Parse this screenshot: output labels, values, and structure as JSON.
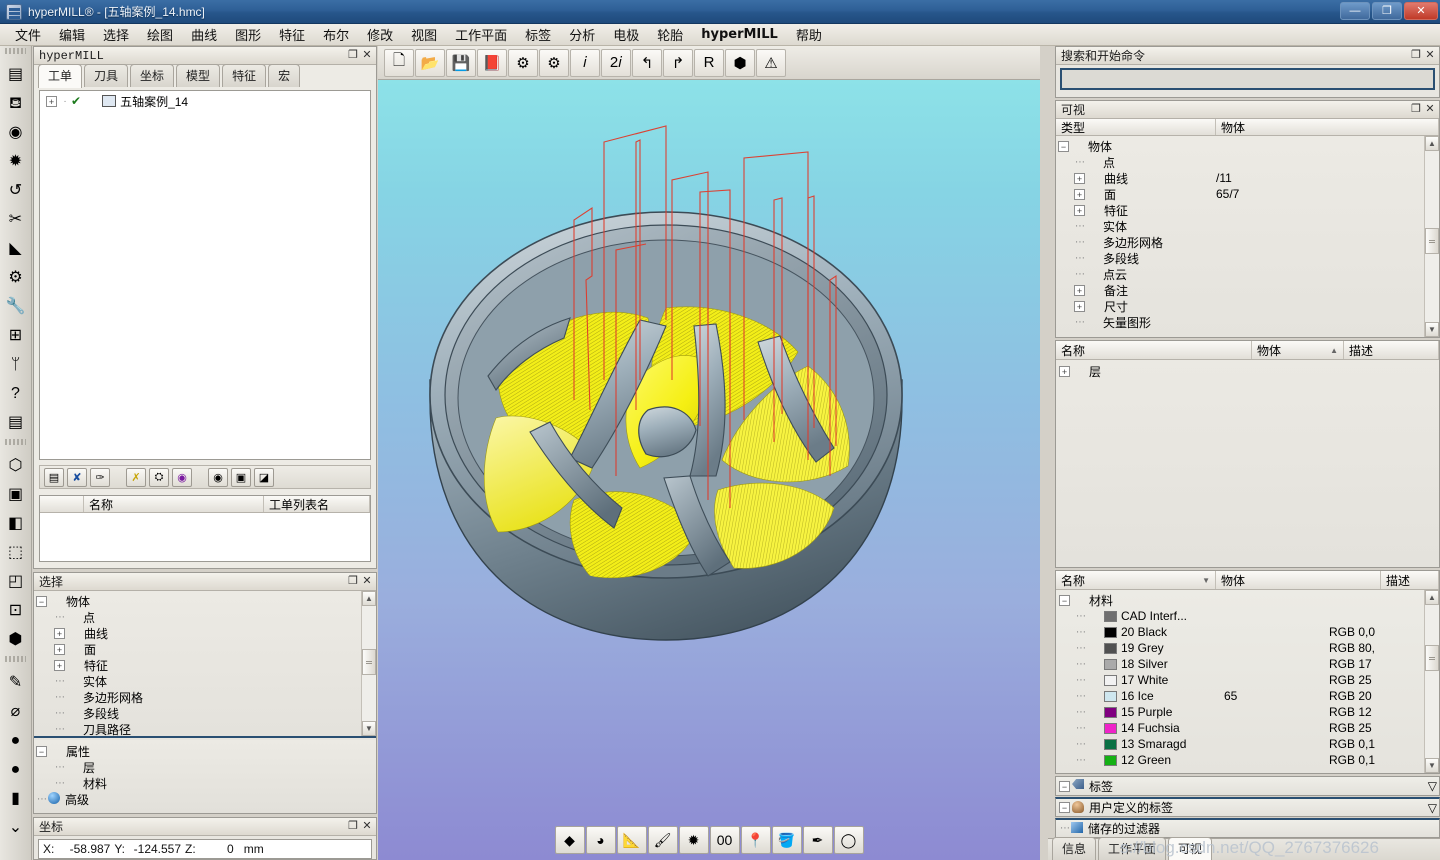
{
  "window": {
    "title": "hyperMILL® - [五轴案例_14.hmc]",
    "minimize_label": "—",
    "maximize_label": "❐",
    "close_label": "✕"
  },
  "menu": {
    "items": [
      {
        "label": "文件"
      },
      {
        "label": "编辑"
      },
      {
        "label": "选择"
      },
      {
        "label": "绘图"
      },
      {
        "label": "曲线"
      },
      {
        "label": "图形"
      },
      {
        "label": "特征"
      },
      {
        "label": "布尔"
      },
      {
        "label": "修改"
      },
      {
        "label": "视图"
      },
      {
        "label": "工作平面"
      },
      {
        "label": "标签"
      },
      {
        "label": "分析"
      },
      {
        "label": "电极"
      },
      {
        "label": "轮胎"
      },
      {
        "label": "hyperMILL"
      },
      {
        "label": "帮助"
      }
    ]
  },
  "left_toolbar": {
    "group1": [
      {
        "icon": "layers-icon",
        "glyph": "▤"
      },
      {
        "icon": "pour-icon",
        "glyph": "⛾"
      },
      {
        "icon": "target-disc-icon",
        "glyph": "◉"
      },
      {
        "icon": "star-layers-icon",
        "glyph": "✹"
      },
      {
        "icon": "undo-arrow-icon",
        "glyph": "↺"
      },
      {
        "icon": "scissors-icon",
        "glyph": "✂"
      },
      {
        "icon": "ribbon-icon",
        "glyph": "◣"
      },
      {
        "icon": "machine-icon",
        "glyph": "⚙"
      },
      {
        "icon": "wrench-icon",
        "glyph": "🔧"
      },
      {
        "icon": "grid-four-icon",
        "glyph": "⊞"
      },
      {
        "icon": "figure-icon",
        "glyph": "ᛘ"
      },
      {
        "icon": "help-question-icon",
        "glyph": "?"
      },
      {
        "icon": "document-list-icon",
        "glyph": "▤"
      }
    ],
    "group2": [
      {
        "icon": "cube-iso-icon",
        "glyph": "⬡"
      },
      {
        "icon": "cube-solid-icon",
        "glyph": "▣"
      },
      {
        "icon": "cube-shaded-icon",
        "glyph": "◧"
      },
      {
        "icon": "cube-wire-icon",
        "glyph": "⬚"
      },
      {
        "icon": "cube-hidden-icon",
        "glyph": "◰"
      },
      {
        "icon": "cube-axis-icon",
        "glyph": "⊡"
      },
      {
        "icon": "cube-mesh-icon",
        "glyph": "⬢"
      }
    ],
    "group3": [
      {
        "icon": "axis-paint-icon",
        "glyph": "✎"
      },
      {
        "icon": "circle-tool-icon",
        "glyph": "⌀"
      },
      {
        "icon": "orange-render-icon",
        "glyph": "●"
      },
      {
        "icon": "red-render-icon",
        "glyph": "●"
      },
      {
        "icon": "blue-cylinder-icon",
        "glyph": "▮"
      },
      {
        "icon": "chevron-down-icon",
        "glyph": "⌄"
      }
    ]
  },
  "top_toolbar": {
    "buttons": [
      {
        "name": "new-file-button",
        "glyph": "🗋"
      },
      {
        "name": "open-file-button",
        "glyph": "📂"
      },
      {
        "name": "save-file-button",
        "glyph": "💾"
      },
      {
        "name": "close-file-button",
        "glyph": "📕"
      },
      {
        "name": "settings-gear-button",
        "glyph": "⚙"
      },
      {
        "name": "gear-10-button",
        "glyph": "⚙"
      },
      {
        "name": "info-blue-button",
        "glyph": "𝑖"
      },
      {
        "name": "info-green-2i-button",
        "glyph": "2𝑖"
      },
      {
        "name": "undo-button",
        "glyph": "↰"
      },
      {
        "name": "redo-button",
        "glyph": "↱"
      },
      {
        "name": "reset-r-button",
        "glyph": "R"
      },
      {
        "name": "stock-box-button",
        "glyph": "⬢"
      },
      {
        "name": "warning-button",
        "glyph": "⚠"
      }
    ]
  },
  "bottom_toolbar": {
    "buttons": [
      {
        "name": "shade-black-button",
        "glyph": "◆"
      },
      {
        "name": "globe-render-button",
        "glyph": "◕"
      },
      {
        "name": "measure-button",
        "glyph": "📐"
      },
      {
        "name": "brush-button",
        "glyph": "🖌"
      },
      {
        "name": "star-tool-button",
        "glyph": "✹"
      },
      {
        "name": "zero-zero-button",
        "glyph": "00"
      },
      {
        "name": "pin-button",
        "glyph": "📍"
      },
      {
        "name": "paint-bucket-button",
        "glyph": "🪣"
      },
      {
        "name": "pen-button",
        "glyph": "✒"
      },
      {
        "name": "wireframe-sphere-button",
        "glyph": "◯"
      }
    ]
  },
  "panels": {
    "hypermill": {
      "title": "hyperMILL",
      "float_label": "❐",
      "close_label": "✕",
      "tabs": [
        {
          "label": "工单",
          "active": true
        },
        {
          "label": "刀具",
          "active": false
        },
        {
          "label": "坐标",
          "active": false
        },
        {
          "label": "模型",
          "active": false
        },
        {
          "label": "特征",
          "active": false
        },
        {
          "label": "宏",
          "active": false
        }
      ],
      "tree": [
        {
          "label": "五轴案例_14",
          "expander": "+",
          "check": "✔"
        }
      ],
      "toolbar": [
        {
          "name": "job-properties-button",
          "glyph": "▤"
        },
        {
          "name": "delete-job-button",
          "glyph": "✘"
        },
        {
          "name": "comment-button",
          "glyph": "✑"
        },
        {
          "name": "spacer",
          "glyph": ""
        },
        {
          "name": "calculate-button",
          "glyph": "✗"
        },
        {
          "name": "post-process-button",
          "glyph": "⛭"
        },
        {
          "name": "simulate-button",
          "glyph": "◉"
        },
        {
          "name": "spacer2",
          "glyph": ""
        },
        {
          "name": "view-machine-button",
          "glyph": "◉"
        },
        {
          "name": "report-button",
          "glyph": "▣"
        },
        {
          "name": "statistics-button",
          "glyph": "◪"
        }
      ],
      "list_columns": [
        {
          "label": ""
        },
        {
          "label": "名称"
        },
        {
          "label": "工单列表名"
        }
      ]
    },
    "selection": {
      "title": "选择",
      "float_label": "❐",
      "close_label": "✕",
      "tree": [
        {
          "label": "物体",
          "level": 0,
          "expander": "−",
          "icon": "yellow-leaf-icon"
        },
        {
          "label": "点",
          "level": 1,
          "expander": "",
          "icon": "green-leaf-icon"
        },
        {
          "label": "曲线",
          "level": 1,
          "expander": "+",
          "icon": "yellow-leaf-icon"
        },
        {
          "label": "面",
          "level": 1,
          "expander": "+",
          "icon": "green-leaf-icon"
        },
        {
          "label": "特征",
          "level": 1,
          "expander": "+",
          "icon": "green-leaf-icon",
          "extra": "blue-cube-icon"
        },
        {
          "label": "实体",
          "level": 1,
          "expander": "",
          "icon": "green-leaf-icon",
          "extra": "blue-cube-icon"
        },
        {
          "label": "多边形网格",
          "level": 1,
          "expander": "",
          "icon": "green-leaf-icon"
        },
        {
          "label": "多段线",
          "level": 1,
          "expander": "",
          "icon": "green-leaf-icon"
        },
        {
          "label": "刀具路径",
          "level": 1,
          "expander": "",
          "icon": "green-leaf-icon"
        }
      ],
      "props_tree": [
        {
          "label": "属性",
          "level": 0,
          "expander": "−",
          "icon": "green-leaf-icon",
          "pens": 1
        },
        {
          "label": "层",
          "level": 1,
          "expander": "",
          "icon": "green-leaf-icon",
          "pens": 2
        },
        {
          "label": "材料",
          "level": 1,
          "expander": "",
          "icon": "green-leaf-icon",
          "pens": 2
        },
        {
          "label": "高级",
          "level": 0,
          "expander": "",
          "icon": "blue-gear-icon",
          "pens": 1
        }
      ]
    },
    "coordinates": {
      "title": "坐标",
      "float_label": "❐",
      "close_label": "✕",
      "x_label": "X:",
      "x_value": "-58.987",
      "y_label": "Y:",
      "y_value": "-124.557",
      "z_label": "Z:",
      "z_value": "0",
      "unit": "mm"
    },
    "search": {
      "title": "搜索和开始命令",
      "float_label": "❐",
      "close_label": "✕",
      "value": "",
      "placeholder": ""
    },
    "visibility": {
      "title": "可视",
      "float_label": "❐",
      "close_label": "✕",
      "columns": [
        {
          "label": "类型"
        },
        {
          "label": "物体"
        }
      ],
      "rows": [
        {
          "label": "物体",
          "level": 0,
          "expander": "−",
          "count": ""
        },
        {
          "label": "点",
          "level": 1,
          "expander": "",
          "count": ""
        },
        {
          "label": "曲线",
          "level": 1,
          "expander": "+",
          "count": "/11"
        },
        {
          "label": "面",
          "level": 1,
          "expander": "+",
          "count": "65/7"
        },
        {
          "label": "特征",
          "level": 1,
          "expander": "+",
          "count": "",
          "extra": "orange-cube-icon"
        },
        {
          "label": "实体",
          "level": 1,
          "expander": "",
          "count": "",
          "extra": "orange-cube-icon"
        },
        {
          "label": "多边形网格",
          "level": 1,
          "expander": "",
          "count": ""
        },
        {
          "label": "多段线",
          "level": 1,
          "expander": "",
          "count": ""
        },
        {
          "label": "点云",
          "level": 1,
          "expander": "",
          "count": ""
        },
        {
          "label": "备注",
          "level": 1,
          "expander": "+",
          "count": ""
        },
        {
          "label": "尺寸",
          "level": 1,
          "expander": "+",
          "count": ""
        },
        {
          "label": "矢量图形",
          "level": 1,
          "expander": "",
          "count": ""
        }
      ]
    },
    "layers": {
      "columns": [
        {
          "label": "名称"
        },
        {
          "label": "物体"
        },
        {
          "label": "描述"
        }
      ],
      "sort_indicator": "▲",
      "rows": [
        {
          "label": "层",
          "expander": "+",
          "objects": "",
          "description": ""
        }
      ]
    },
    "materials": {
      "columns": [
        {
          "label": "名称"
        },
        {
          "label": "物体"
        },
        {
          "label": "描述"
        }
      ],
      "sort_indicator": "▼",
      "root": {
        "label": "材料",
        "expander": "−"
      },
      "rows": [
        {
          "label": "CAD Interf...",
          "color": "#6f6f6f",
          "objects": "",
          "description": ""
        },
        {
          "label": "20 Black",
          "color": "#000000",
          "objects": "",
          "description": "RGB 0,0"
        },
        {
          "label": "19 Grey",
          "color": "#505050",
          "objects": "",
          "description": "RGB 80,"
        },
        {
          "label": "18 Silver",
          "color": "#aaaaaa",
          "objects": "",
          "description": "RGB 17"
        },
        {
          "label": "17 White",
          "color": "#f2f2f2",
          "objects": "",
          "description": "RGB 25"
        },
        {
          "label": "16 Ice",
          "color": "#cfe7ef",
          "objects": "65",
          "description": "RGB 20"
        },
        {
          "label": "15 Purple",
          "color": "#800080",
          "objects": "",
          "description": "RGB 12"
        },
        {
          "label": "14 Fuchsia",
          "color": "#ef23c8",
          "objects": "",
          "description": "RGB 25"
        },
        {
          "label": "13 Smaragd",
          "color": "#0a7044",
          "objects": "",
          "description": "RGB 0,1"
        },
        {
          "label": "12 Green",
          "color": "#14b014",
          "objects": "",
          "description": "RGB 0,1"
        }
      ]
    },
    "bottom_groups": [
      {
        "label": "标签",
        "icon": "tag-icon",
        "expander": "−",
        "chev": "▽"
      },
      {
        "label": "用户定义的标签",
        "icon": "user-icon",
        "expander": "−",
        "chev": "▽"
      },
      {
        "label": "储存的过滤器",
        "icon": "filter-icon",
        "expander": "",
        "chev": ""
      }
    ],
    "status_tabs": [
      {
        "label": "信息",
        "active": false
      },
      {
        "label": "工作平面",
        "active": false
      },
      {
        "label": "可视",
        "active": true
      }
    ]
  },
  "watermark": {
    "text": "s://blog.csdn.net/QQ_2767376626"
  },
  "viewport": {
    "model_name": "impeller-toolpath-model",
    "bg_top": "#8fe6e9",
    "bg_bottom": "#8d8ad2",
    "toolpath_color": "#f5f000",
    "approach_color": "#e03a2a",
    "surface_color": "#9fb0bb"
  }
}
